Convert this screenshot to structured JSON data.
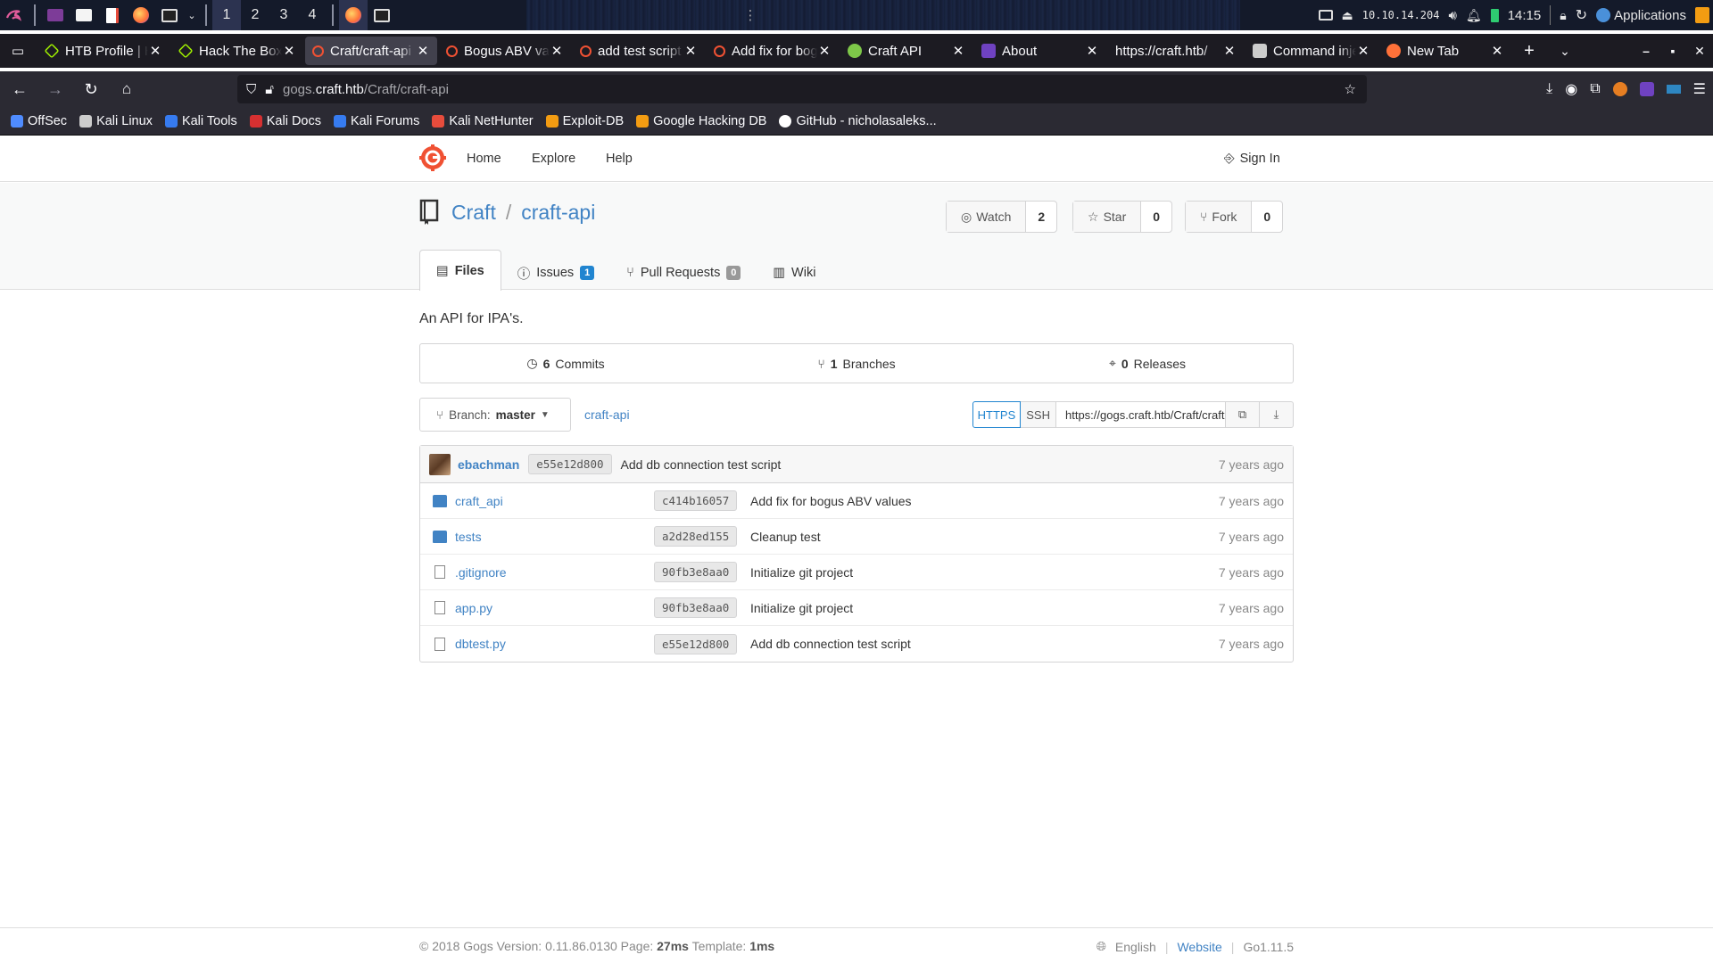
{
  "panel": {
    "workspaces": [
      "1",
      "2",
      "3",
      "4"
    ],
    "active_workspace": "1",
    "ip": "10.10.14.204",
    "clock": "14:15",
    "applications_label": "Applications"
  },
  "tabs": [
    {
      "title": "HTB Profile | H",
      "fav": "htb-cube-icon",
      "fav_color": "#9fef00",
      "active": false
    },
    {
      "title": "Hack The Box :",
      "fav": "htb-cube-icon",
      "fav_color": "#9fef00",
      "active": false
    },
    {
      "title": "Craft/craft-api",
      "fav": "gogs-icon",
      "fav_color": "#f05133",
      "active": true
    },
    {
      "title": "Bogus ABV val",
      "fav": "gogs-icon",
      "fav_color": "#f05133",
      "active": false
    },
    {
      "title": "add test script",
      "fav": "gogs-icon",
      "fav_color": "#f05133",
      "active": false
    },
    {
      "title": "Add fix for bog",
      "fav": "gogs-icon",
      "fav_color": "#f05133",
      "active": false
    },
    {
      "title": "Craft API",
      "fav": "craft-api-icon",
      "fav_color": "#7ec849",
      "active": false
    },
    {
      "title": "About",
      "fav": "bootstrap-icon",
      "fav_color": "#6f42c1",
      "active": false
    },
    {
      "title": "https://craft.htb/",
      "fav": "none",
      "fav_color": "",
      "active": false
    },
    {
      "title": "Command inje",
      "fav": "site-icon",
      "fav_color": "#cccccc",
      "active": false
    },
    {
      "title": "New Tab",
      "fav": "firefox-icon",
      "fav_color": "#ff7139",
      "active": false
    }
  ],
  "url": {
    "prefix": "gogs.",
    "host": "craft.htb",
    "path": "/Craft/craft-api"
  },
  "bookmarks": [
    {
      "label": "OffSec",
      "icon": "offsec-icon",
      "color": "#4f8cff"
    },
    {
      "label": "Kali Linux",
      "icon": "kali-icon",
      "color": "#cccccc"
    },
    {
      "label": "Kali Tools",
      "icon": "kali-tools-icon",
      "color": "#367bf0"
    },
    {
      "label": "Kali Docs",
      "icon": "kali-docs-icon",
      "color": "#d63031"
    },
    {
      "label": "Kali Forums",
      "icon": "kali-forums-icon",
      "color": "#367bf0"
    },
    {
      "label": "Kali NetHunter",
      "icon": "nethunter-icon",
      "color": "#e74c3c"
    },
    {
      "label": "Exploit-DB",
      "icon": "exploitdb-icon",
      "color": "#f39c12"
    },
    {
      "label": "Google Hacking DB",
      "icon": "ghdb-icon",
      "color": "#f39c12"
    },
    {
      "label": "GitHub - nicholasaleks...",
      "icon": "github-icon",
      "color": "#ffffff"
    }
  ],
  "gogs": {
    "nav": {
      "home": "Home",
      "explore": "Explore",
      "help": "Help",
      "sign_in": "Sign In"
    },
    "repo": {
      "owner": "Craft",
      "name": "craft-api",
      "description": "An API for IPA's."
    },
    "buttons": {
      "watch": {
        "label": "Watch",
        "count": "2"
      },
      "star": {
        "label": "Star",
        "count": "0"
      },
      "fork": {
        "label": "Fork",
        "count": "0"
      }
    },
    "tabs": {
      "files": "Files",
      "issues": "Issues",
      "issues_count": "1",
      "pulls": "Pull Requests",
      "pulls_count": "0",
      "wiki": "Wiki"
    },
    "stats": {
      "commits_num": "6",
      "commits_label": "Commits",
      "branches_num": "1",
      "branches_label": "Branches",
      "releases_num": "0",
      "releases_label": "Releases"
    },
    "branch": {
      "label": "Branch:",
      "value": "master",
      "crumb": "craft-api"
    },
    "clone": {
      "https": "HTTPS",
      "ssh": "SSH",
      "url": "https://gogs.craft.htb/Craft/craft-api.git"
    },
    "latest_commit": {
      "author": "ebachman",
      "sha": "e55e12d800",
      "message": "Add db connection test script",
      "when": "7 years ago"
    },
    "files": [
      {
        "name": "craft_api",
        "type": "folder",
        "sha": "c414b16057",
        "message": "Add fix for bogus ABV values",
        "when": "7 years ago"
      },
      {
        "name": "tests",
        "type": "folder",
        "sha": "a2d28ed155",
        "message": "Cleanup test",
        "when": "7 years ago"
      },
      {
        "name": ".gitignore",
        "type": "file",
        "sha": "90fb3e8aa0",
        "message": "Initialize git project",
        "when": "7 years ago"
      },
      {
        "name": "app.py",
        "type": "file",
        "sha": "90fb3e8aa0",
        "message": "Initialize git project",
        "when": "7 years ago"
      },
      {
        "name": "dbtest.py",
        "type": "file",
        "sha": "e55e12d800",
        "message": "Add db connection test script",
        "when": "7 years ago"
      }
    ],
    "footer": {
      "copyright": "© 2018 Gogs Version: 0.11.86.0130 Page:",
      "page_time": "27ms",
      "template_label": "Template:",
      "template_time": "1ms",
      "language": "English",
      "website": "Website",
      "go_version": "Go1.11.5"
    }
  },
  "colors": {
    "link": "#4183c4",
    "accent": "#2185d0",
    "browser_bg": "#1c1b22",
    "toolbar": "#2b2a33"
  }
}
